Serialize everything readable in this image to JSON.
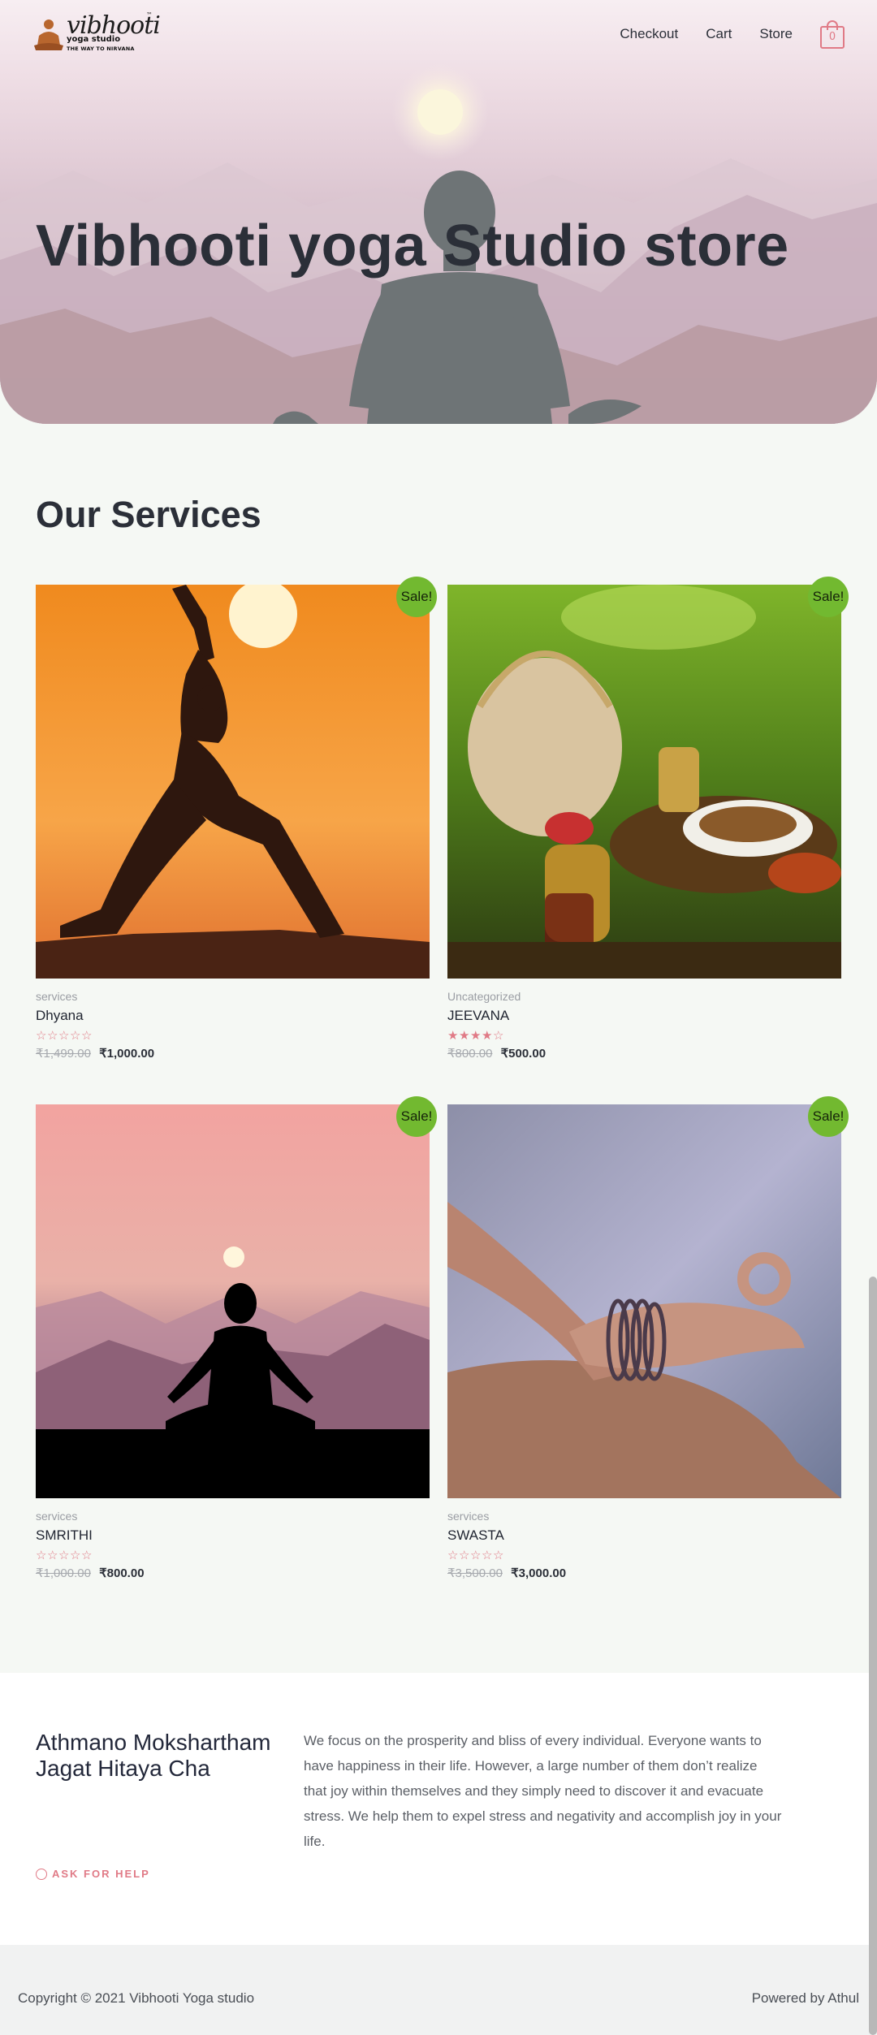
{
  "header": {
    "logo": {
      "word": "vibhooti",
      "tm": "™",
      "sub": "yoga studio",
      "tagline": "THE WAY TO NIRVANA"
    },
    "nav": [
      "Checkout",
      "Cart",
      "Store"
    ],
    "cart_count": "0"
  },
  "hero": {
    "title": "Vibhooti yoga Studio store"
  },
  "services": {
    "title": "Our Services",
    "sale_label": "Sale!",
    "products": [
      {
        "category": "services",
        "name": "Dhyana",
        "rating": 0,
        "old_price": "₹1,499.00",
        "new_price": "₹1,000.00"
      },
      {
        "category": "Uncategorized",
        "name": "JEEVANA",
        "rating": 4,
        "old_price": "₹800.00",
        "new_price": "₹500.00"
      },
      {
        "category": "services",
        "name": "SMRITHI",
        "rating": 0,
        "old_price": "₹1,000.00",
        "new_price": "₹800.00"
      },
      {
        "category": "services",
        "name": "SWASTA",
        "rating": 0,
        "old_price": "₹3,500.00",
        "new_price": "₹3,000.00"
      }
    ]
  },
  "about": {
    "motto": "Athmano Mokshartham Jagat Hitaya Cha",
    "description": "We focus on the prosperity and bliss of every individual. Everyone wants to have happiness in their life. However, a large number of them don’t realize that joy within themselves and they simply need to discover it and evacuate stress. We help them to expel stress and negativity and accomplish joy in your life.",
    "help_label": "ASK FOR HELP"
  },
  "footer": {
    "copyright": "Copyright © 2021 Vibhooti Yoga studio",
    "powered": "Powered by Athul"
  },
  "colors": {
    "accent": "#e07a86",
    "sale": "#72b930",
    "text": "#2b2f38"
  }
}
